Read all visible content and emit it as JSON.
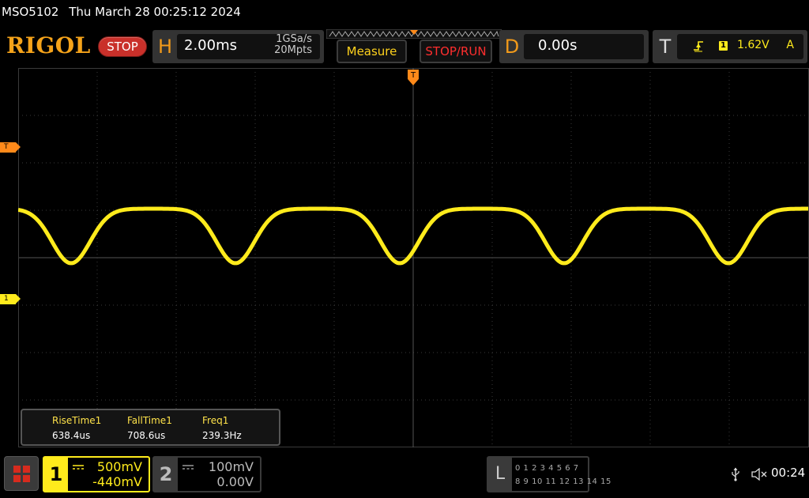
{
  "status": {
    "model": "MSO5102",
    "datetime": "Thu March 28 00:25:12 2024"
  },
  "brand": "RIGOL",
  "run_state": "STOP",
  "horizontal": {
    "letter": "H",
    "timebase": "2.00ms",
    "sample_rate": "1GSa/s",
    "memory_depth": "20Mpts"
  },
  "buttons": {
    "measure": "Measure",
    "stop_run": "STOP/RUN"
  },
  "delay": {
    "letter": "D",
    "value": "0.00s"
  },
  "trigger": {
    "letter": "T",
    "edge_icon": "rising-edge-icon",
    "source": "1",
    "level": "1.62V",
    "mode": "A"
  },
  "markers": {
    "trigger_level": "T",
    "channel1": "1"
  },
  "measurements": [
    {
      "name": "RiseTime1",
      "value": "638.4us"
    },
    {
      "name": "FallTime1",
      "value": "708.6us"
    },
    {
      "name": "Freq1",
      "value": "239.3Hz"
    }
  ],
  "channels": [
    {
      "number": "1",
      "scale": "500mV",
      "offset": "-440mV",
      "coupling": "DC",
      "color": "#ffeb1c",
      "active": true
    },
    {
      "number": "2",
      "scale": "100mV",
      "offset": "0.00V",
      "coupling": "DC",
      "color": "#bbbbbb",
      "active": false
    }
  ],
  "logic": {
    "label": "L",
    "row1": "0 1 2 3  4 5 6 7",
    "row2": "8 9 10 11 12 13 14 15"
  },
  "bottom": {
    "usb_icon": "usb-icon",
    "sound_icon": "speaker-muted-icon",
    "time": "00:24"
  },
  "colors": {
    "ch1": "#ffeb1c",
    "trigger": "#ff8a1a",
    "brand": "#f5a31a",
    "stop": "#c9302a"
  }
}
